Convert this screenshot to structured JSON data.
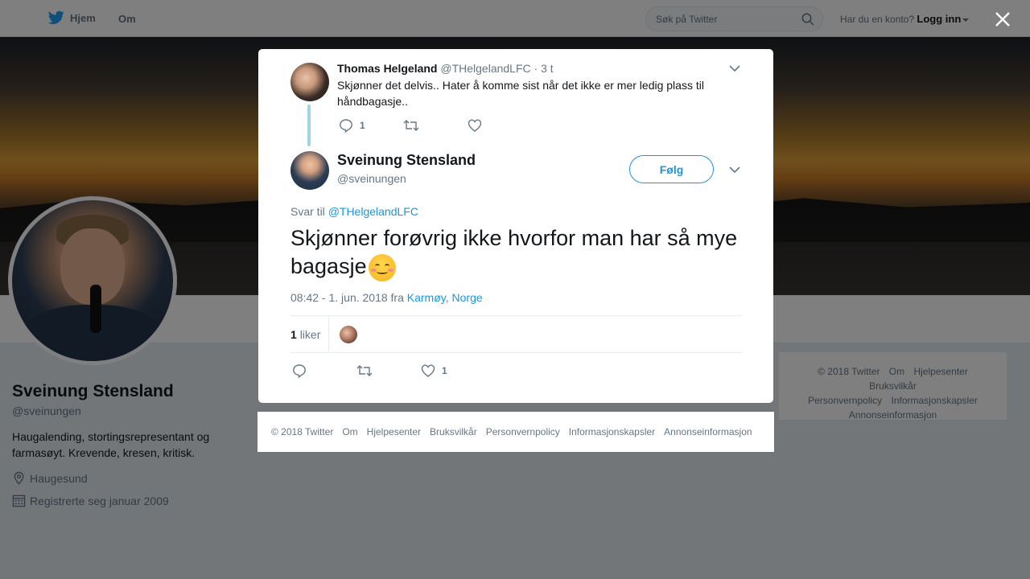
{
  "nav": {
    "home_label": "Hjem",
    "about_label": "Om",
    "search_placeholder": "Søk på Twitter",
    "account_prompt": "Har du en konto?",
    "login_label": "Logg inn"
  },
  "profile": {
    "name": "Sveinung Stensland",
    "handle": "@sveinungen",
    "bio": "Haugalending, stortingsrepresentant og farmasøyt. Krevende, kresen, kritisk.",
    "location": "Haugesund",
    "joined": "Registrerte seg januar 2009"
  },
  "side_footer": {
    "links": [
      "© 2018 Twitter",
      "Om",
      "Hjelpesenter",
      "Bruksvilkår",
      "Personvernpolicy",
      "Informasjonskapsler",
      "Annonseinformasjon"
    ]
  },
  "parent_tweet": {
    "author_name": "Thomas Helgeland",
    "author_handle": "@THelgelandLFC",
    "time": "· 3 t",
    "text": "Skjønner det delvis.. Hater å komme sist når det ikke er mer ledig plass til håndbagasje..",
    "reply_count": "1"
  },
  "main_tweet": {
    "author_name": "Sveinung Stensland",
    "author_handle": "@sveinungen",
    "follow_label": "Følg",
    "reply_prefix": "Svar til",
    "reply_to": "@THelgelandLFC",
    "text": "Skjønner forøvrig ikke hvorfor man har så mye bagasje",
    "timestamp": "08:42 - 1. jun. 2018 fra",
    "location": "Karmøy, Norge",
    "like_count": "1",
    "likes_label": "liker",
    "footer_like_count": "1"
  },
  "modal_footer": {
    "links": [
      "© 2018 Twitter",
      "Om",
      "Hjelpesenter",
      "Bruksvilkår",
      "Personvernpolicy",
      "Informasjonskapsler",
      "Annonseinformasjon"
    ]
  },
  "colors": {
    "accent": "#1b95e0",
    "thread_line": "#9fd4e6",
    "secondary_text": "#657786"
  }
}
